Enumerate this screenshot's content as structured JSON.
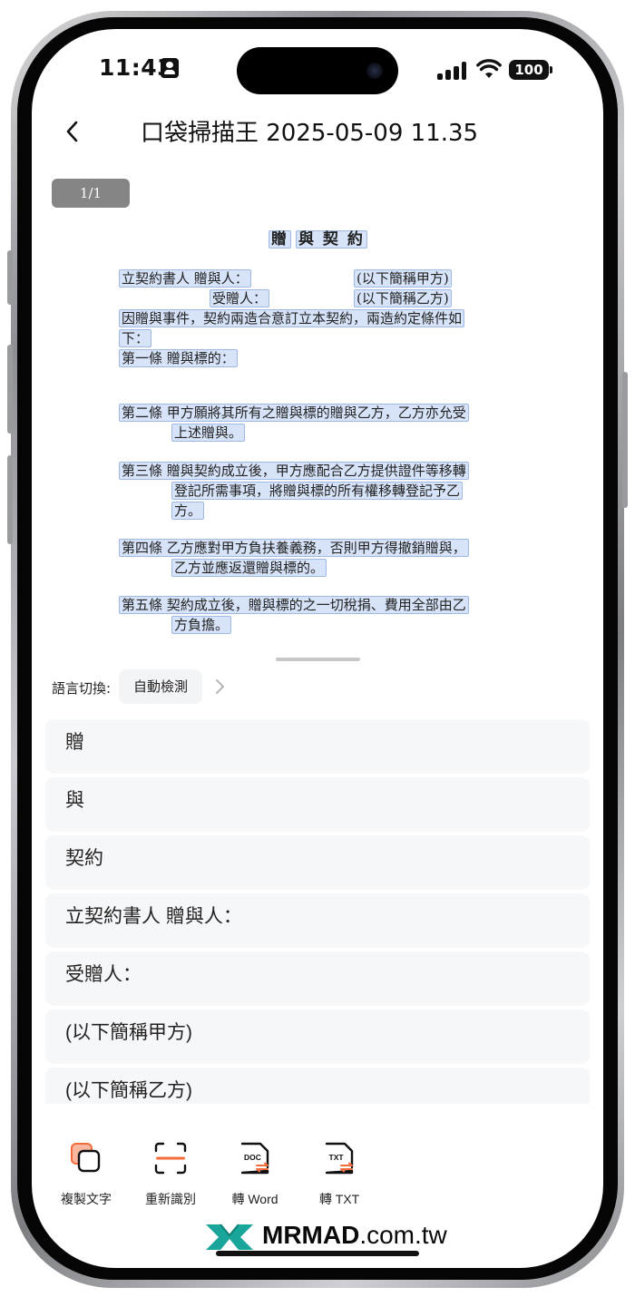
{
  "status_bar": {
    "time": "11:43",
    "battery": "100"
  },
  "header": {
    "title": "口袋掃描王 2025-05-09 11.35"
  },
  "document": {
    "page_indicator": "1/1",
    "lines": {
      "title_a": "贈",
      "title_b": "與  契  約",
      "l1a": "立契約書人  贈與人：",
      "l1b": "(以下簡稱甲方)",
      "l2a": "受贈人：",
      "l2b": "(以下簡稱乙方)",
      "l3": "因贈與事件，契約兩造合意訂立本契約，兩造約定條件如",
      "l4": "下：",
      "l5": "第一條 贈與標的：",
      "l6": "第二條  甲方願將其所有之贈與標的贈與乙方，乙方亦允受",
      "l7": "上述贈與。",
      "l8": "第三條  贈與契約成立後，甲方應配合乙方提供證件等移轉",
      "l9": "登記所需事項，將贈與標的所有權移轉登記予乙",
      "l10": "方。",
      "l11": "第四條  乙方應對甲方負扶養義務，否則甲方得撤銷贈與，",
      "l12": "乙方並應返還贈與標的。",
      "l13": "第五條  契約成立後，贈與標的之一切稅捐、費用全部由乙",
      "l14": "方負擔。"
    }
  },
  "language": {
    "label": "語言切換:",
    "value": "自動檢測"
  },
  "results": [
    {
      "text": "贈"
    },
    {
      "text": "與"
    },
    {
      "text": "契約"
    },
    {
      "text": "立契約書人 贈與人："
    },
    {
      "text": "受贈人："
    },
    {
      "text": "(以下簡稱甲方)"
    },
    {
      "text": "(以下簡稱乙方)"
    }
  ],
  "toolbar": {
    "copy": "複製文字",
    "rescan": "重新識別",
    "to_word": "轉 Word",
    "to_txt": "轉 TXT",
    "doc_badge": "DOC",
    "txt_badge": "TXT"
  },
  "watermark": {
    "brand": "MRMAD",
    "tld": ".com.tw"
  },
  "colors": {
    "accent": "#f26b3a",
    "highlight": "#d6e3f8",
    "watermark_logo": "#19a59a"
  }
}
